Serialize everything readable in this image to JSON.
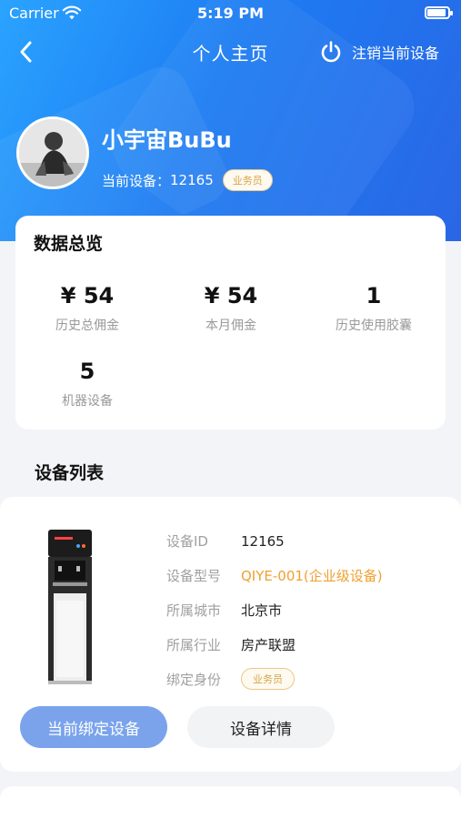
{
  "status_bar": {
    "carrier": "Carrier",
    "time": "5:19 PM"
  },
  "nav": {
    "title": "个人主页",
    "logout_label": "注销当前设备"
  },
  "profile": {
    "username": "小宇宙BuBu",
    "device_label": "当前设备：",
    "device_id": "12165",
    "role": "业务员"
  },
  "overview": {
    "heading": "数据总览",
    "stats": [
      {
        "value": "¥ 54",
        "label": "历史总佣金"
      },
      {
        "value": "¥ 54",
        "label": "本月佣金"
      },
      {
        "value": "1",
        "label": "历史使用胶囊"
      },
      {
        "value": "5",
        "label": "机器设备"
      }
    ]
  },
  "device_list": {
    "title": "设备列表",
    "device": {
      "id_label": "设备ID",
      "id_value": "12165",
      "model_label": "设备型号",
      "model_value": "QIYE-001(企业级设备)",
      "city_label": "所属城市",
      "city_value": "北京市",
      "industry_label": "所属行业",
      "industry_value": "房产联盟",
      "identity_label": "绑定身份",
      "identity_value": "业务员"
    },
    "current_button": "当前绑定设备",
    "detail_button": "设备详情"
  },
  "colors": {
    "accent": "#1d7cf2",
    "orange": "#f0a030",
    "button_blue": "#7aa3ec"
  }
}
